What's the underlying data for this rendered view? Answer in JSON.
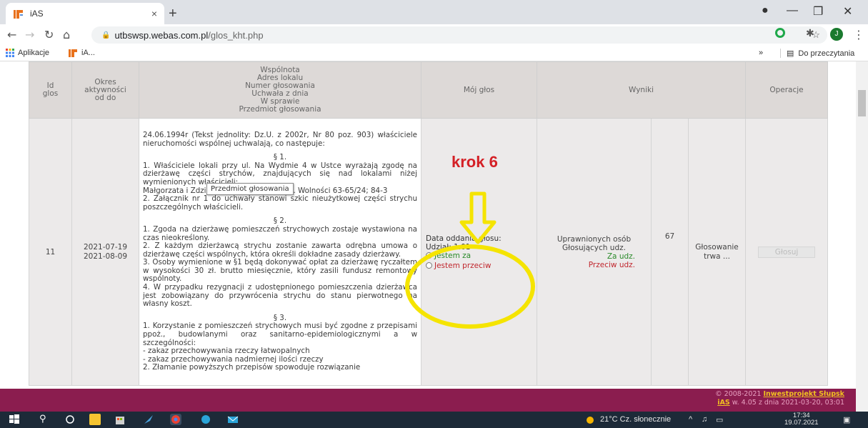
{
  "browser": {
    "tab_title": "iAS",
    "tab_close": "×",
    "new_tab": "+",
    "url_host": "utbswsp.webas.com.pl",
    "url_path": "/glos_kht.php",
    "bookmarks": [
      {
        "label": "Aplikacje"
      },
      {
        "label": "iA..."
      }
    ],
    "bookmarks_more": "»",
    "reading_list": "Do przeczytania",
    "profile_initial": "J"
  },
  "table": {
    "headers": {
      "id": "Id\nglos",
      "okres": "Okres\naktywności\nod do",
      "wspolnota_lines": [
        "Wspólnota",
        "Adres lokalu",
        "Numer głosowania",
        "Uchwała z dnia",
        "W sprawie",
        "Przedmiot głosowania"
      ],
      "moj_glos": "Mój głos",
      "wyniki": "Wyniki",
      "operacje": "Operacje"
    },
    "row": {
      "id": "11",
      "date_from": "2021-07-19",
      "date_to": "2021-08-09",
      "text_paragraphs": [
        "24.06.1994r (Tekst jednolity: Dz.U. z 2002r, Nr 80 poz. 903) właściciele nieruchomości wspólnej uchwalają, co następuje:",
        "§ 1.",
        "1.  Właściciele lokali przy ul. Na Wydmie 4 w Ustce wyrażają zgodę na dzierżawę części strychów, znajdujących się nad lokalami niżej wymienionych właścicieli:",
        "Małgorzata i Zdzisław Domańscy zam. Al. Wolności 63-65/24; 84-3",
        "2.  Załącznik nr 1 do uchwały stanowi szkic nieużytkowej części strychu poszczególnych właścicieli.",
        "§ 2.",
        "1.  Zgoda na dzierżawę pomieszczeń strychowych zostaje wystawiona na czas nieokreślony.",
        "2.  Z każdym dzierżawcą strychu zostanie zawarta odrębna umowa o dzierżawę części wspólnych, która określi dokładne zasady dzierżawy.",
        "3.  Osoby wymienione w §1 będą dokonywać opłat za dzierżawę ryczałtem w wysokości 30 zł. brutto miesięcznie, który zasili fundusz remontowy wspólnoty.",
        "4.  W przypadku rezygnacji z udostępnionego pomieszczenia dzierżawca jest zobowiązany do przywrócenia strychu do stanu pierwotnego na własny koszt.",
        "§ 3.",
        "1.  Korzystanie z pomieszczeń strychowych musi być zgodne z przepisami ppoż., budowlanymi oraz sanitarno-epidemiologicznymi a w szczególności:",
        "- zakaz przechowywania rzeczy łatwopalnych",
        "- zakaz przechowywania nadmiernej ilości rzeczy",
        "2.  Złamanie powyższych przepisów spowoduje rozwiązanie"
      ],
      "tooltip": "Przedmiot głosowania",
      "vote": {
        "date_label": "Data oddania głosu:",
        "udzial": "Udział: 1.01",
        "for_label": "Jestem za",
        "against_label": "Jestem przeciw"
      },
      "results": {
        "line1": "Uprawnionych osób",
        "line2": "Głosujących udz.",
        "line3": "Za udz.",
        "line4": "Przeciw udz.",
        "count": "67",
        "status": "Głosowanie\ntrwa ..."
      },
      "action_button": "Głosuj"
    }
  },
  "annotation": {
    "label": "krok 6"
  },
  "footer": {
    "copyright_prefix": "© 2008-2021",
    "company": "Inwestprojekt Słupsk",
    "app": "iAS",
    "version_text": "w. 4.05 z dnia 2021-03-20, 03:01"
  },
  "taskbar": {
    "weather": "21°C  Cz. słonecznie",
    "time": "17:34",
    "date": "19.07.2021"
  },
  "colors": {
    "footer_bg": "#8b1d4f",
    "annotation_red": "#d42026",
    "highlight_yellow": "#f5e400"
  }
}
